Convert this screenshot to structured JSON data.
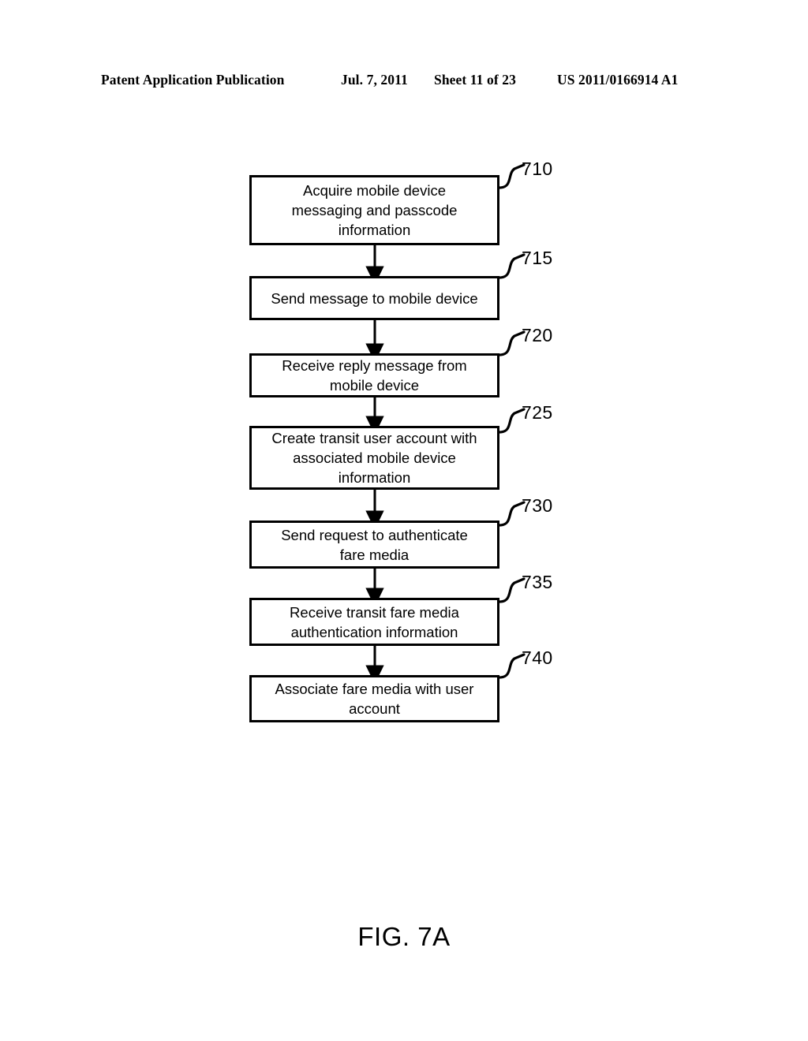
{
  "header": {
    "publication": "Patent Application Publication",
    "date": "Jul. 7, 2011",
    "sheet": "Sheet 11 of 23",
    "patent_number": "US 2011/0166914 A1"
  },
  "figure": {
    "caption": "FIG. 7A",
    "type": "flowchart",
    "orientation": "vertical",
    "stroke_color": "#000000",
    "background_color": "#ffffff",
    "nodes": [
      {
        "ref": "710",
        "text": "Acquire mobile device\nmessaging and passcode\ninformation"
      },
      {
        "ref": "715",
        "text": "Send message to mobile device"
      },
      {
        "ref": "720",
        "text": "Receive reply message from\nmobile device"
      },
      {
        "ref": "725",
        "text": "Create transit user account with\nassociated mobile device\ninformation"
      },
      {
        "ref": "730",
        "text": "Send request to authenticate\nfare media"
      },
      {
        "ref": "735",
        "text": "Receive transit fare media\nauthentication information"
      },
      {
        "ref": "740",
        "text": "Associate fare media with user\naccount"
      }
    ],
    "connectors": [
      {
        "from": "710",
        "to": "715",
        "style": "arrow-down"
      },
      {
        "from": "715",
        "to": "720",
        "style": "arrow-down"
      },
      {
        "from": "720",
        "to": "725",
        "style": "arrow-down"
      },
      {
        "from": "725",
        "to": "730",
        "style": "arrow-down"
      },
      {
        "from": "730",
        "to": "735",
        "style": "arrow-down"
      },
      {
        "from": "735",
        "to": "740",
        "style": "arrow-down"
      }
    ]
  }
}
